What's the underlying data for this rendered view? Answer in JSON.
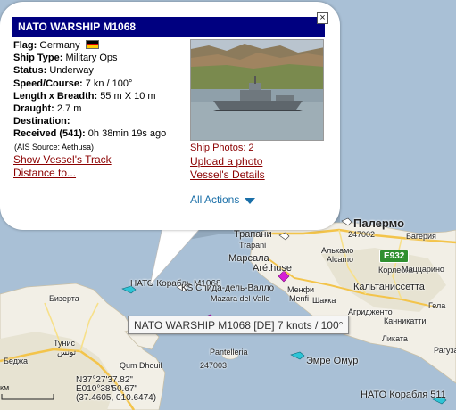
{
  "popup": {
    "title": "NATO WARSHIP M1068",
    "close_label": "×",
    "flag_label": "Flag:",
    "flag_value": "Germany",
    "flag_colors": [
      "#000000",
      "#dd0000",
      "#ffce00"
    ],
    "ship_type_label": "Ship Type:",
    "ship_type_value": "Military Ops",
    "status_label": "Status:",
    "status_value": "Underway",
    "speed_label": "Speed/Course:",
    "speed_value": "7 kn / 100°",
    "dims_label": "Length x Breadth:",
    "dims_value": "55 m X 10 m",
    "draught_label": "Draught:",
    "draught_value": "2.7 m",
    "destination_label": "Destination:",
    "destination_value": "",
    "received_label": "Received (541):",
    "received_value": "0h 38min 19s ago",
    "ais_source": "(AIS Source: Aethusa)",
    "show_track_link": "Show Vessel's Track",
    "distance_link": "Distance to...",
    "ship_photos_link": "Ship Photos: 2",
    "upload_photo_link": "Upload a photo",
    "vessel_details_link": "Vessel's Details",
    "all_actions_label": "All Actions",
    "accent_color": "#000080",
    "link_color": "#8b0000"
  },
  "tooltip": {
    "text": "NATO WARSHIP M1068 [DE] 7 knots / 100°"
  },
  "map": {
    "labels": {
      "palermo": "Палермо",
      "palermo_id": "247002",
      "trapani_ru": "Трапани",
      "trapani": "Trapani",
      "alkamo": "Алькамо",
      "alcamo": "Alcamo",
      "bagheria": "Багерия",
      "corleone": "Корлеоне",
      "marsala": "Марсала",
      "arethuse": "Aréthuse",
      "menfi_ru": "Менфи",
      "menfi": "Menfi",
      "mazara": "Mazara del Vallo",
      "caltanissetta": "Кальтаниссетта",
      "mazzarino": "Маццарино",
      "canicatti": "Канникатти",
      "licata": "Ликата",
      "gela": "Гела",
      "agrigento": "Агридженто",
      "sciacca": "Шакка",
      "ragusa": "Рагуза",
      "pantelleria": "Pantelleria",
      "pantelleria_id": "247003",
      "tunis_ru": "Тунис",
      "tunis_ar": "تونس",
      "bizerte": "Бизерта",
      "beja": "Беджа",
      "cap_bon": "Qum Dhouil",
      "road_e932": "E932",
      "nato_vessel": "НАТО Корабль M1068",
      "ks_vessel": "KS Спида-дель-Валло",
      "emre_omur": "Эмре Омур",
      "nato_511": "НАТО Корабля 511"
    },
    "scale_unit": "км",
    "coords_line1": "N37°27'37.82\"",
    "coords_line2": "E010°38'50.67\"",
    "coords_line3": "(37.4605, 010.6474)",
    "colors": {
      "sea": "#a9c0d6",
      "land": "#f2efe6",
      "land_alt": "#e7e3d2",
      "road_major": "#f3c44b",
      "road_minor": "#f7e08a",
      "vessel_cyan": "#2ec4d6",
      "vessel_magenta": "#d61fd6"
    }
  }
}
